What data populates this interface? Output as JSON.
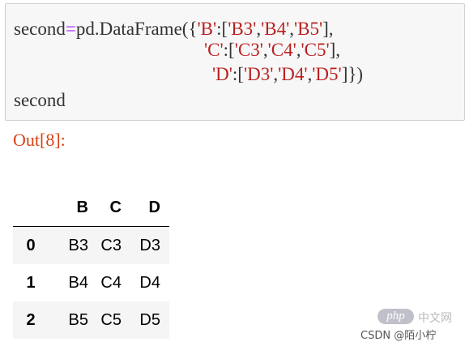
{
  "code_cell": {
    "line1": [
      "second",
      "=",
      "pd.DataFrame({",
      "'B'",
      ":[",
      "'B3'",
      ",",
      "'B4'",
      ",",
      "'B5'",
      "],"
    ],
    "line2": [
      "'C'",
      ":[",
      "'C3'",
      ",",
      "'C4'",
      ",",
      "'C5'",
      "],"
    ],
    "line3": [
      "'D'",
      ":[",
      "'D3'",
      ",",
      "'D4'",
      ",",
      "'D5'",
      "]})"
    ],
    "line4": "second"
  },
  "output": {
    "prompt": "Out[8]:"
  },
  "dataframe": {
    "columns": [
      "B",
      "C",
      "D"
    ],
    "rows": [
      {
        "index": "0",
        "values": [
          "B3",
          "C3",
          "D3"
        ]
      },
      {
        "index": "1",
        "values": [
          "B4",
          "C4",
          "D4"
        ]
      },
      {
        "index": "2",
        "values": [
          "B5",
          "C5",
          "D5"
        ]
      }
    ]
  },
  "watermark": {
    "logo": "php",
    "site": "中文网",
    "author": "CSDN @陌小柠"
  },
  "colors": {
    "string": "#ba2121",
    "operator": "#aa22ff",
    "prompt": "#d84315"
  }
}
